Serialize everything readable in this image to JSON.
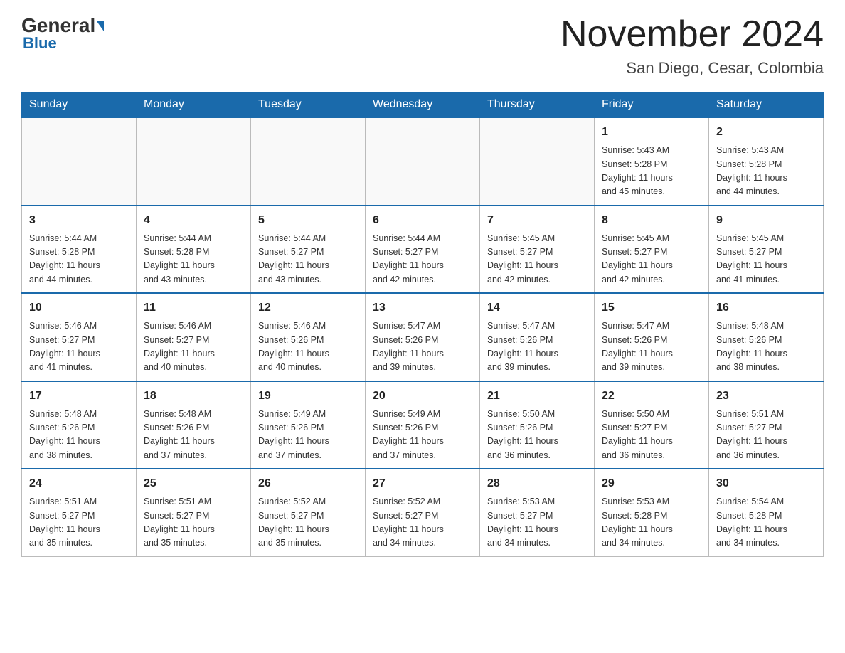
{
  "header": {
    "logo_general": "General",
    "logo_blue": "Blue",
    "month_title": "November 2024",
    "location": "San Diego, Cesar, Colombia"
  },
  "days_of_week": [
    "Sunday",
    "Monday",
    "Tuesday",
    "Wednesday",
    "Thursday",
    "Friday",
    "Saturday"
  ],
  "weeks": [
    {
      "days": [
        {
          "number": "",
          "info": ""
        },
        {
          "number": "",
          "info": ""
        },
        {
          "number": "",
          "info": ""
        },
        {
          "number": "",
          "info": ""
        },
        {
          "number": "",
          "info": ""
        },
        {
          "number": "1",
          "info": "Sunrise: 5:43 AM\nSunset: 5:28 PM\nDaylight: 11 hours\nand 45 minutes."
        },
        {
          "number": "2",
          "info": "Sunrise: 5:43 AM\nSunset: 5:28 PM\nDaylight: 11 hours\nand 44 minutes."
        }
      ]
    },
    {
      "days": [
        {
          "number": "3",
          "info": "Sunrise: 5:44 AM\nSunset: 5:28 PM\nDaylight: 11 hours\nand 44 minutes."
        },
        {
          "number": "4",
          "info": "Sunrise: 5:44 AM\nSunset: 5:28 PM\nDaylight: 11 hours\nand 43 minutes."
        },
        {
          "number": "5",
          "info": "Sunrise: 5:44 AM\nSunset: 5:27 PM\nDaylight: 11 hours\nand 43 minutes."
        },
        {
          "number": "6",
          "info": "Sunrise: 5:44 AM\nSunset: 5:27 PM\nDaylight: 11 hours\nand 42 minutes."
        },
        {
          "number": "7",
          "info": "Sunrise: 5:45 AM\nSunset: 5:27 PM\nDaylight: 11 hours\nand 42 minutes."
        },
        {
          "number": "8",
          "info": "Sunrise: 5:45 AM\nSunset: 5:27 PM\nDaylight: 11 hours\nand 42 minutes."
        },
        {
          "number": "9",
          "info": "Sunrise: 5:45 AM\nSunset: 5:27 PM\nDaylight: 11 hours\nand 41 minutes."
        }
      ]
    },
    {
      "days": [
        {
          "number": "10",
          "info": "Sunrise: 5:46 AM\nSunset: 5:27 PM\nDaylight: 11 hours\nand 41 minutes."
        },
        {
          "number": "11",
          "info": "Sunrise: 5:46 AM\nSunset: 5:27 PM\nDaylight: 11 hours\nand 40 minutes."
        },
        {
          "number": "12",
          "info": "Sunrise: 5:46 AM\nSunset: 5:26 PM\nDaylight: 11 hours\nand 40 minutes."
        },
        {
          "number": "13",
          "info": "Sunrise: 5:47 AM\nSunset: 5:26 PM\nDaylight: 11 hours\nand 39 minutes."
        },
        {
          "number": "14",
          "info": "Sunrise: 5:47 AM\nSunset: 5:26 PM\nDaylight: 11 hours\nand 39 minutes."
        },
        {
          "number": "15",
          "info": "Sunrise: 5:47 AM\nSunset: 5:26 PM\nDaylight: 11 hours\nand 39 minutes."
        },
        {
          "number": "16",
          "info": "Sunrise: 5:48 AM\nSunset: 5:26 PM\nDaylight: 11 hours\nand 38 minutes."
        }
      ]
    },
    {
      "days": [
        {
          "number": "17",
          "info": "Sunrise: 5:48 AM\nSunset: 5:26 PM\nDaylight: 11 hours\nand 38 minutes."
        },
        {
          "number": "18",
          "info": "Sunrise: 5:48 AM\nSunset: 5:26 PM\nDaylight: 11 hours\nand 37 minutes."
        },
        {
          "number": "19",
          "info": "Sunrise: 5:49 AM\nSunset: 5:26 PM\nDaylight: 11 hours\nand 37 minutes."
        },
        {
          "number": "20",
          "info": "Sunrise: 5:49 AM\nSunset: 5:26 PM\nDaylight: 11 hours\nand 37 minutes."
        },
        {
          "number": "21",
          "info": "Sunrise: 5:50 AM\nSunset: 5:26 PM\nDaylight: 11 hours\nand 36 minutes."
        },
        {
          "number": "22",
          "info": "Sunrise: 5:50 AM\nSunset: 5:27 PM\nDaylight: 11 hours\nand 36 minutes."
        },
        {
          "number": "23",
          "info": "Sunrise: 5:51 AM\nSunset: 5:27 PM\nDaylight: 11 hours\nand 36 minutes."
        }
      ]
    },
    {
      "days": [
        {
          "number": "24",
          "info": "Sunrise: 5:51 AM\nSunset: 5:27 PM\nDaylight: 11 hours\nand 35 minutes."
        },
        {
          "number": "25",
          "info": "Sunrise: 5:51 AM\nSunset: 5:27 PM\nDaylight: 11 hours\nand 35 minutes."
        },
        {
          "number": "26",
          "info": "Sunrise: 5:52 AM\nSunset: 5:27 PM\nDaylight: 11 hours\nand 35 minutes."
        },
        {
          "number": "27",
          "info": "Sunrise: 5:52 AM\nSunset: 5:27 PM\nDaylight: 11 hours\nand 34 minutes."
        },
        {
          "number": "28",
          "info": "Sunrise: 5:53 AM\nSunset: 5:27 PM\nDaylight: 11 hours\nand 34 minutes."
        },
        {
          "number": "29",
          "info": "Sunrise: 5:53 AM\nSunset: 5:28 PM\nDaylight: 11 hours\nand 34 minutes."
        },
        {
          "number": "30",
          "info": "Sunrise: 5:54 AM\nSunset: 5:28 PM\nDaylight: 11 hours\nand 34 minutes."
        }
      ]
    }
  ]
}
